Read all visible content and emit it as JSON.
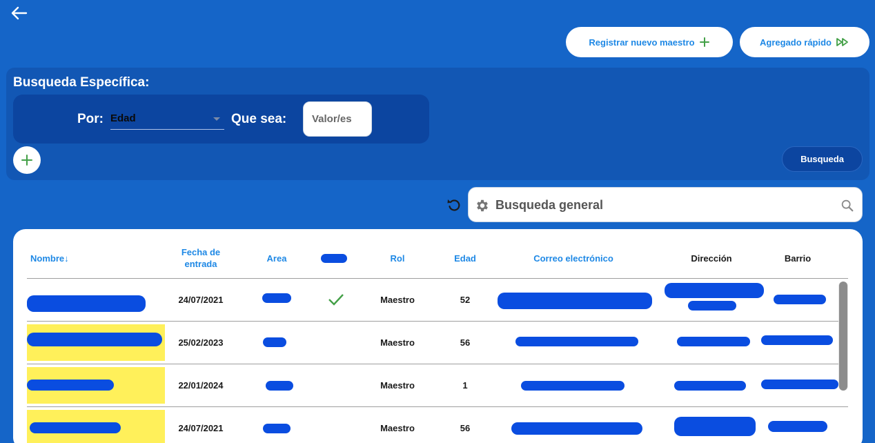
{
  "header": {
    "back_icon": "arrow-left-icon",
    "register_button": "Registrar nuevo maestro",
    "quick_add_button": "Agregado rápido",
    "accent_color": "#1e88e5",
    "plus_color": "#43a047"
  },
  "specific_search": {
    "title": "Busqueda Específica:",
    "por_label": "Por:",
    "field_selected": "Edad",
    "que_sea_label": "Que sea:",
    "value_placeholder": "Valor/es",
    "search_button": "Busqueda"
  },
  "general_search": {
    "placeholder": "Busqueda general"
  },
  "table": {
    "columns": [
      "Nombre↓",
      "Fecha de entrada",
      "Area",
      "",
      "Rol",
      "Edad",
      "Correo electrónico",
      "Dirección",
      "Barrio"
    ],
    "rows": [
      {
        "nombre": "",
        "fecha": "24/07/2021",
        "area": "",
        "active": true,
        "rol": "Maestro",
        "edad": "52",
        "correo": "",
        "direccion": "",
        "barrio": "",
        "highlight": false
      },
      {
        "nombre": "",
        "fecha": "25/02/2023",
        "area": "",
        "active": false,
        "rol": "Maestro",
        "edad": "56",
        "correo": "",
        "direccion": "",
        "barrio": "",
        "highlight": true
      },
      {
        "nombre": "",
        "fecha": "22/01/2024",
        "area": "",
        "active": false,
        "rol": "Maestro",
        "edad": "1",
        "correo": "",
        "direccion": "",
        "barrio": "",
        "highlight": true
      },
      {
        "nombre": "",
        "fecha": "24/07/2021",
        "area": "",
        "active": false,
        "rol": "Maestro",
        "edad": "56",
        "correo": "",
        "direccion": "",
        "barrio": "",
        "highlight": true
      }
    ]
  }
}
